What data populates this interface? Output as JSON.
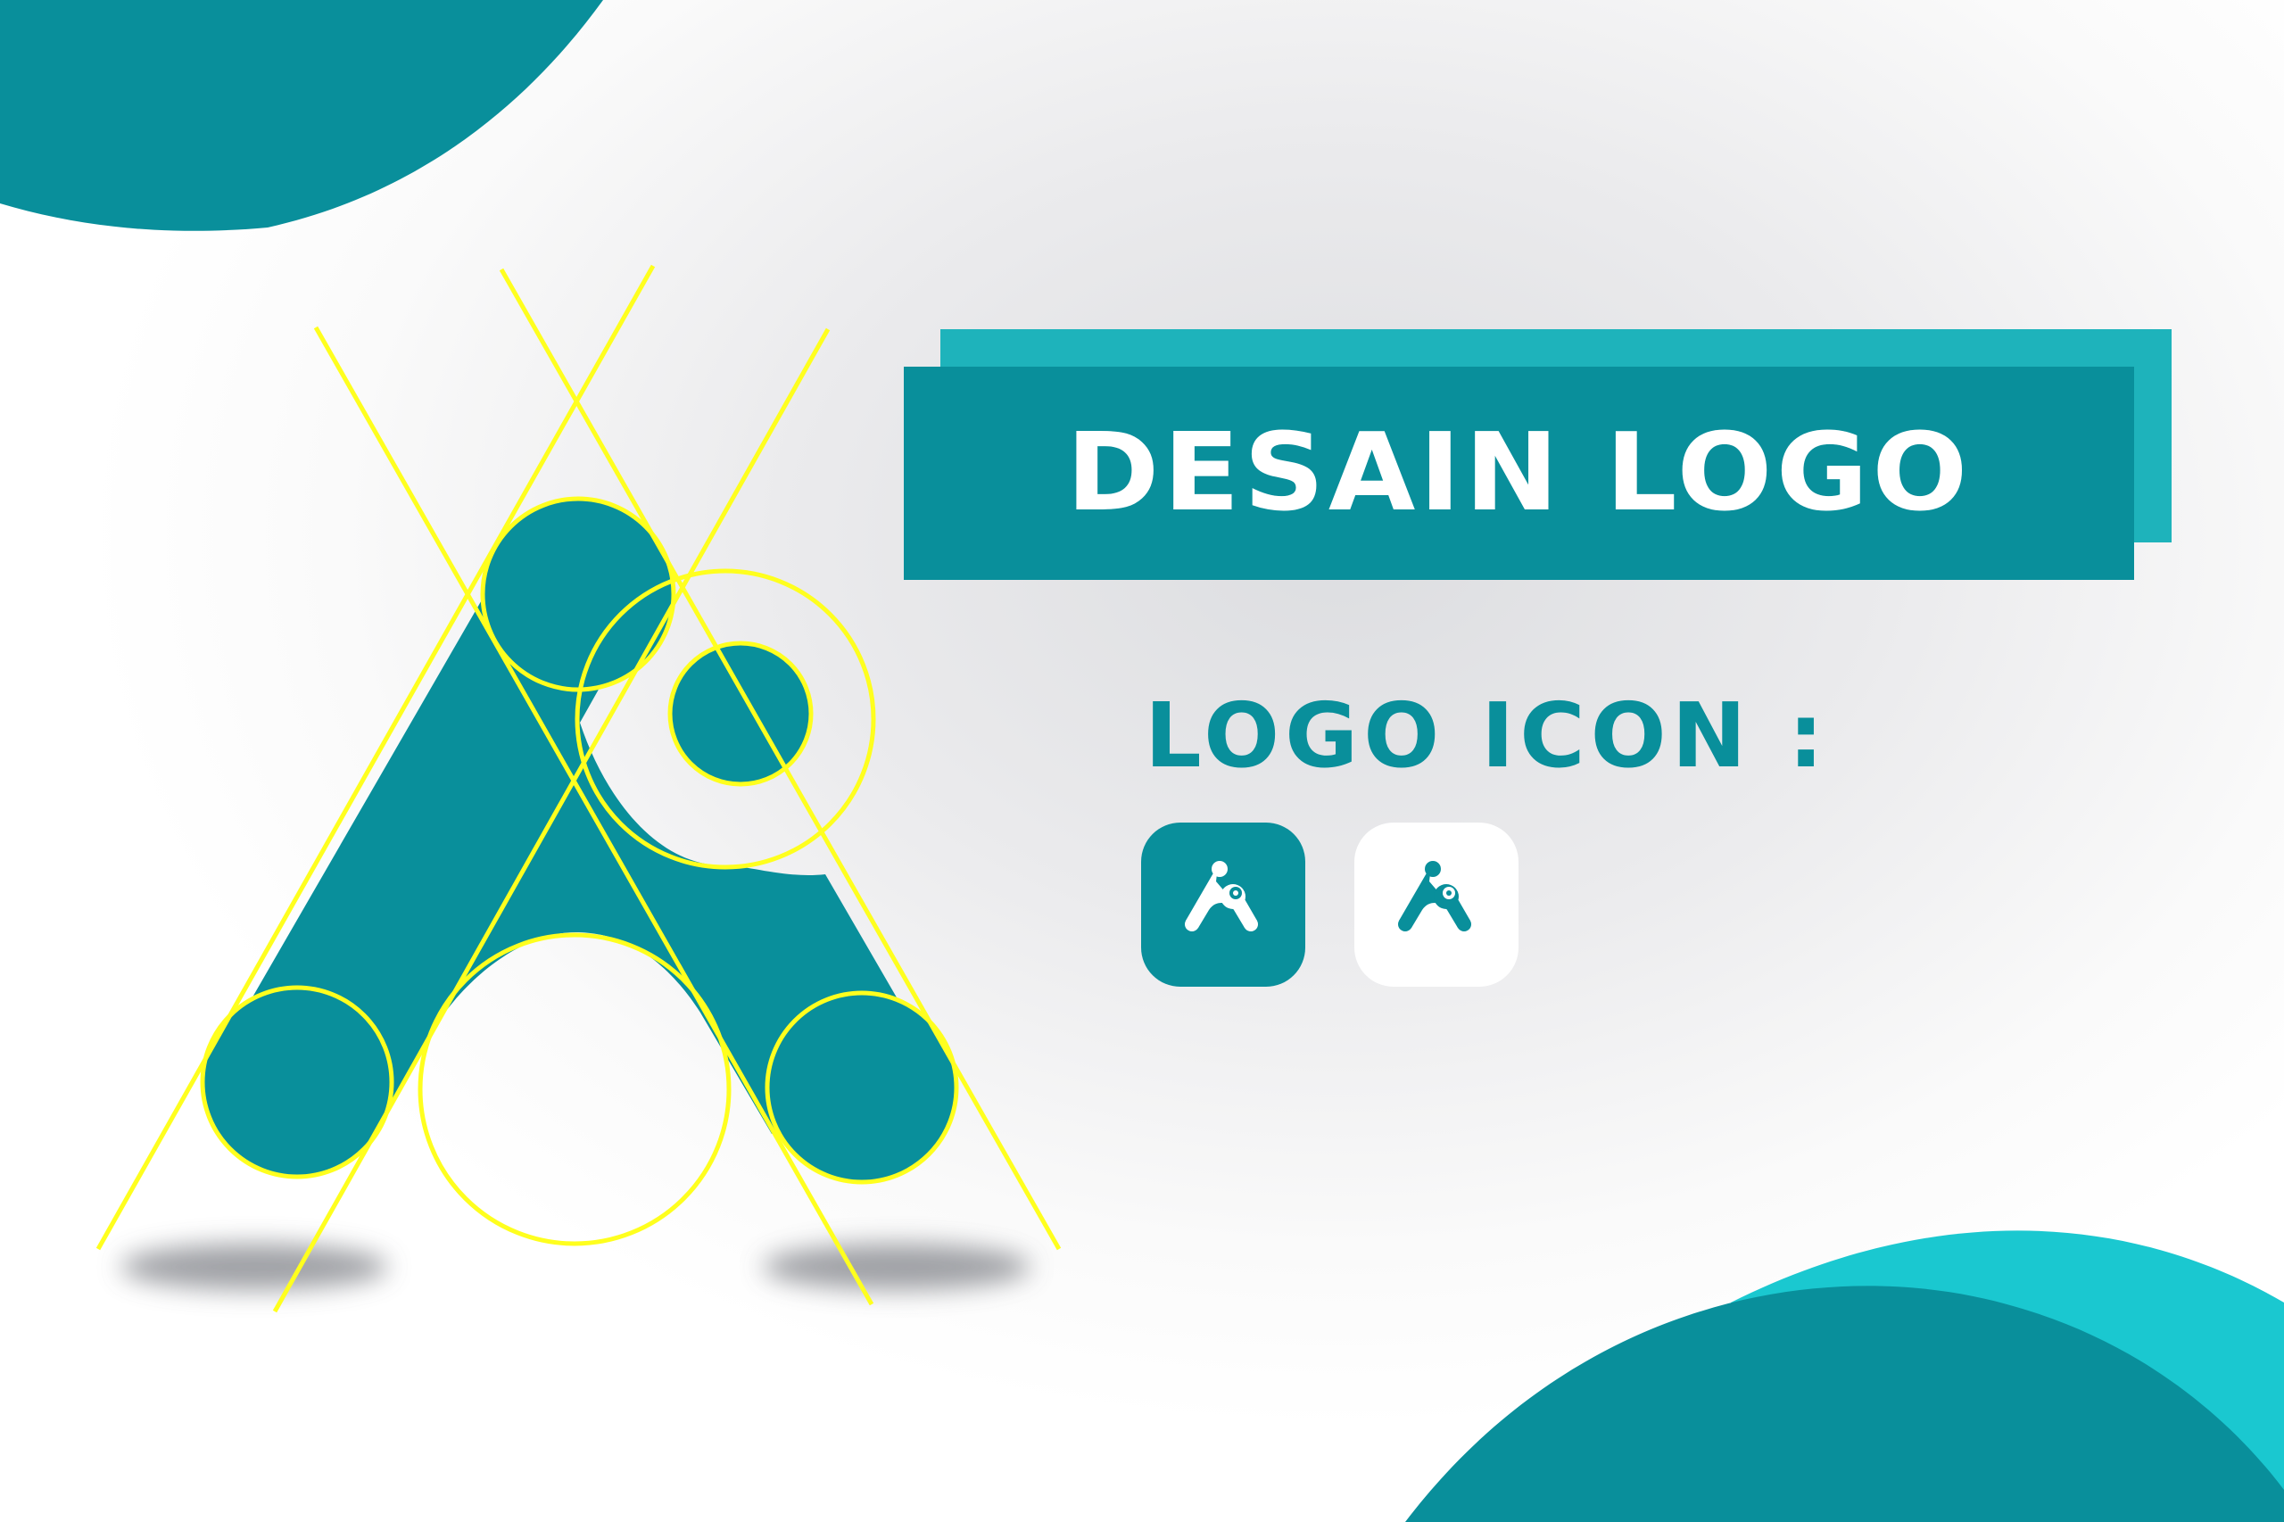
{
  "title": "DESAIN LOGO",
  "subtitle": "LOGO ICON :",
  "colors": {
    "primary": "#098f9b",
    "accent": "#1eb3bb",
    "bright_accent": "#1ac8d0",
    "guide_lines": "#ffff1e",
    "text_light": "#ffffff"
  },
  "logo_icons": [
    {
      "name": "teal-background-logo-icon",
      "background": "#098f9b",
      "mark": "#ffffff"
    },
    {
      "name": "white-background-logo-icon",
      "background": "#ffffff",
      "mark": "#098f9b"
    }
  ]
}
